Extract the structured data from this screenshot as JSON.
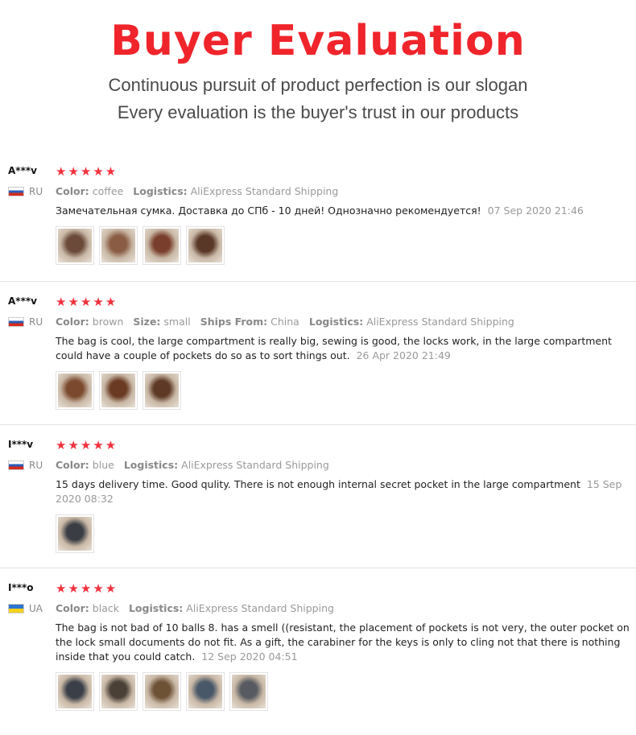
{
  "header": {
    "title": "Buyer Evaluation",
    "slogan_1": "Continuous pursuit of product perfection is our slogan",
    "slogan_2": "Every evaluation is the buyer's trust in our products"
  },
  "colors": {
    "title": "#f0242b",
    "stars": "#f0323d"
  },
  "reviews": [
    {
      "user": "A***v",
      "country": "RU",
      "stars": "★★★★★",
      "attrs": [
        {
          "key": "Color:",
          "value": "coffee"
        },
        {
          "key": "Logistics:",
          "value": "AliExpress Standard Shipping"
        }
      ],
      "text": "Замечательная сумка. Доставка до СПб - 10 дней! Однозначно рекомендуется!",
      "date": "07 Sep 2020 21:46",
      "photos": 4
    },
    {
      "user": "A***v",
      "country": "RU",
      "stars": "★★★★★",
      "attrs": [
        {
          "key": "Color:",
          "value": "brown"
        },
        {
          "key": "Size:",
          "value": "small"
        },
        {
          "key": "Ships From:",
          "value": "China"
        },
        {
          "key": "Logistics:",
          "value": "AliExpress Standard Shipping"
        }
      ],
      "text": "The bag is cool, the large compartment is really big, sewing is good, the locks work, in the large compartment could have a couple of pockets do so as to sort things out.",
      "date": "26 Apr 2020 21:49",
      "photos": 3
    },
    {
      "user": "I***v",
      "country": "RU",
      "stars": "★★★★★",
      "attrs": [
        {
          "key": "Color:",
          "value": "blue"
        },
        {
          "key": "Logistics:",
          "value": "AliExpress Standard Shipping"
        }
      ],
      "text": "15 days delivery time. Good qulity. There is not enough internal secret pocket in the large compartment",
      "date": "15 Sep 2020 08:32",
      "photos": 1
    },
    {
      "user": "I***o",
      "country": "UA",
      "stars": "★★★★★",
      "attrs": [
        {
          "key": "Color:",
          "value": "black"
        },
        {
          "key": "Logistics:",
          "value": "AliExpress Standard Shipping"
        }
      ],
      "text": "The bag is not bad of 10 balls 8. has a smell ((resistant, the placement of pockets is not very, the outer pocket on the lock small documents do not fit. As a gift, the carabiner for the keys is only to cling not that there is nothing inside that you could catch.",
      "date": "12 Sep 2020 04:51",
      "photos": 5
    }
  ]
}
